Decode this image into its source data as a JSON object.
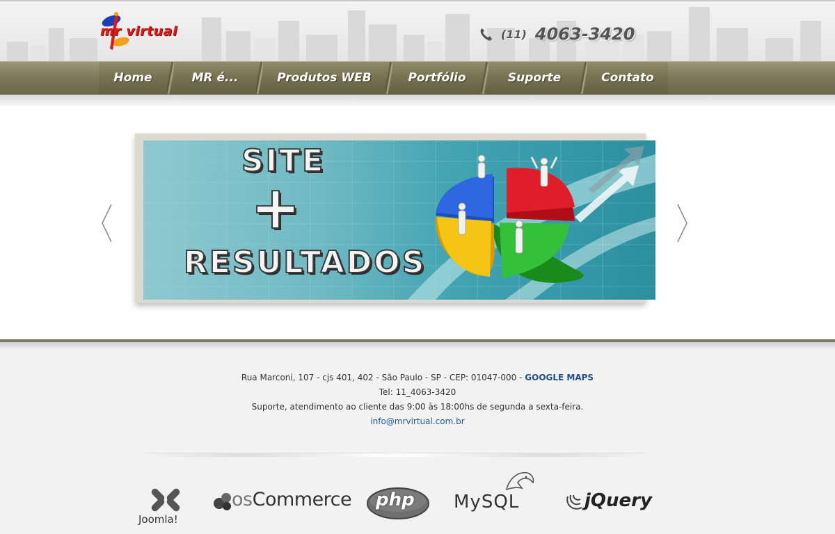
{
  "header": {
    "logo_text": "mr virtual",
    "phone_area": "(11)",
    "phone_number": "4063-3420"
  },
  "nav": {
    "items": [
      "Home",
      "MR é...",
      "Produtos WEB",
      "Portfólio",
      "Suporte",
      "Contato"
    ]
  },
  "banner": {
    "line1": "SITE",
    "line2": "+",
    "line3": "RESULTADOS"
  },
  "footer": {
    "address": "Rua Marconi, 107 - cjs 401, 402 - São Paulo - SP - CEP: 01047-000 - ",
    "maps_link": "GOOGLE MAPS",
    "tel": "Tel: 11_4063-3420",
    "support": "Suporte, atendimento ao cliente das 9:00 às 18:00hs de segunda a sexta-feira.",
    "email": "info@mrvirtual.com.br"
  },
  "tech": {
    "joomla": "Joomla!",
    "oscommerce_os": "os",
    "oscommerce_rest": "Commerce",
    "php": "php",
    "mysql": "MySQL",
    "jquery": "jQuery"
  }
}
